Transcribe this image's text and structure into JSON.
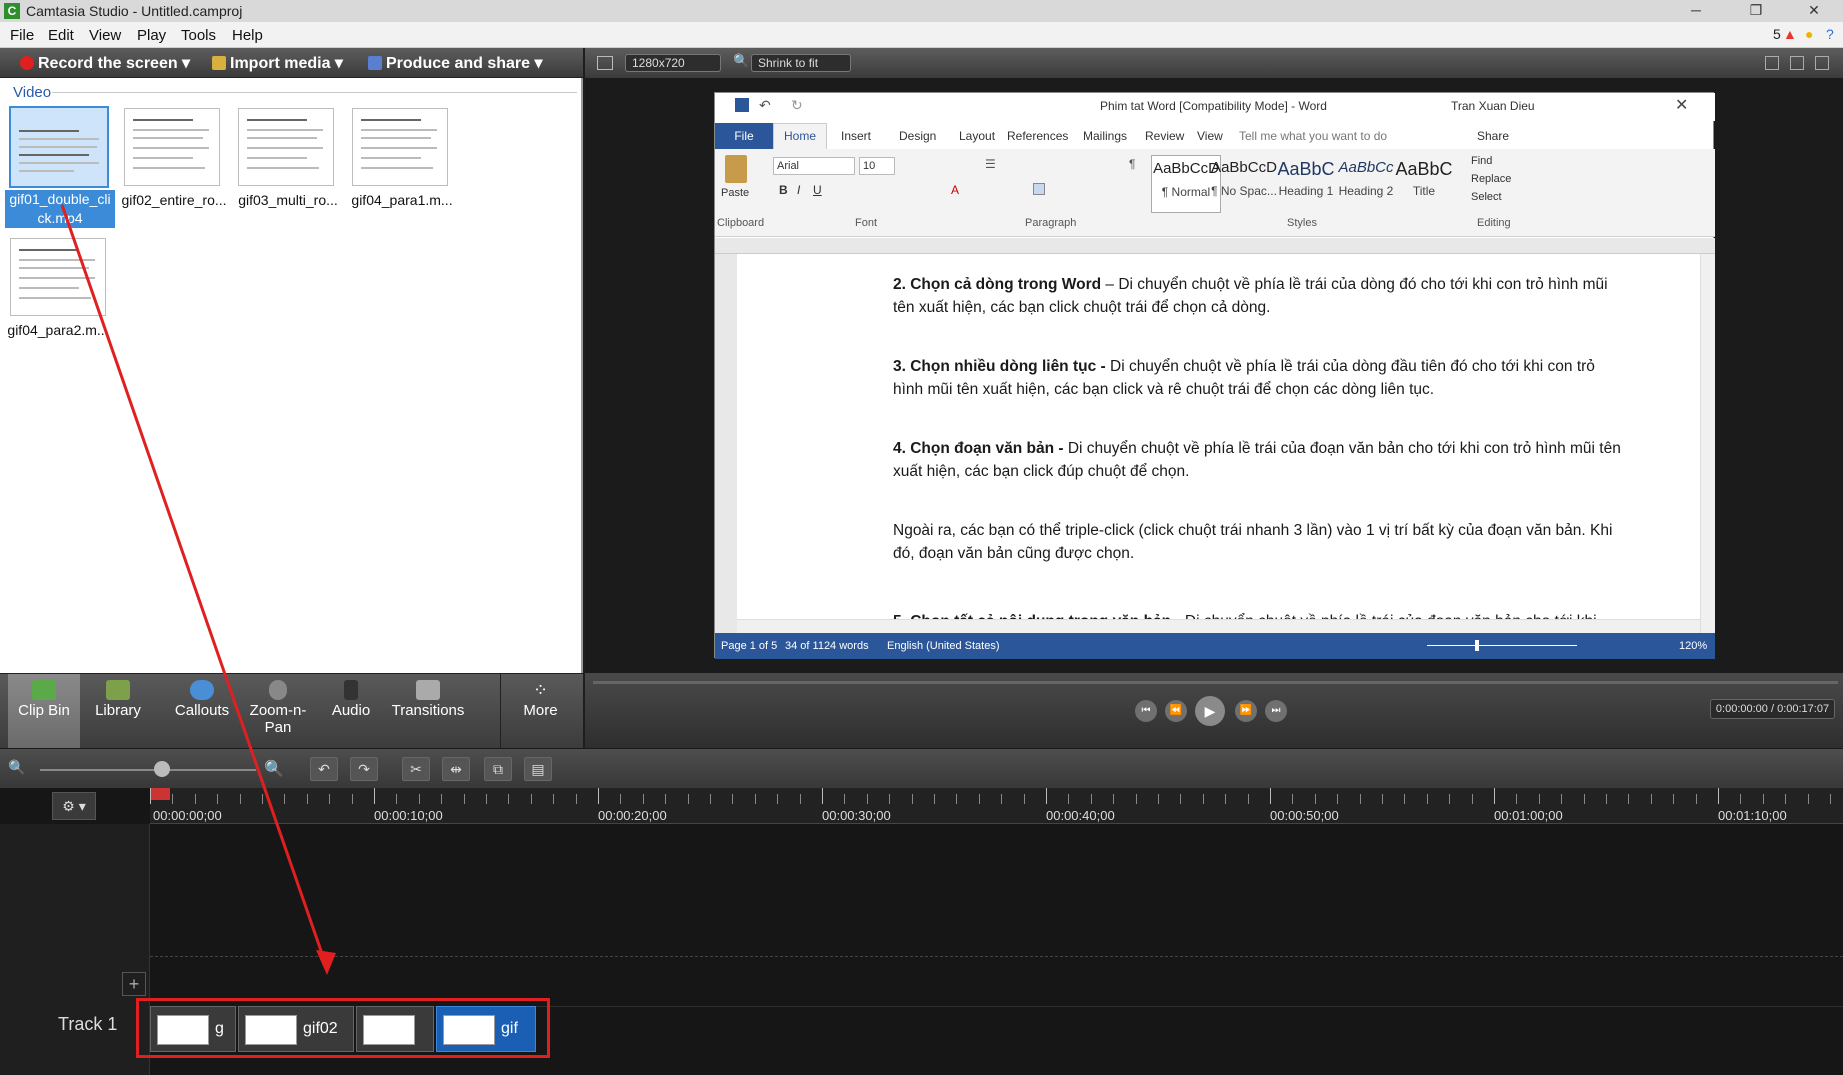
{
  "window": {
    "title": "Camtasia Studio - Untitled.camproj"
  },
  "menu": [
    "File",
    "Edit",
    "View",
    "Play",
    "Tools",
    "Help"
  ],
  "menu_right": {
    "notifications": "5"
  },
  "toolbar": {
    "record": "Record the screen",
    "import": "Import media",
    "produce": "Produce and share"
  },
  "clipbin": {
    "header": "Video",
    "clips": [
      {
        "name": "gif01_double_click.mp4",
        "display": "gif01_double_cli ck.mp4",
        "selected": true
      },
      {
        "name": "gif02_entire_ro...",
        "display": "gif02_entire_ro..."
      },
      {
        "name": "gif03_multi_ro...",
        "display": "gif03_multi_ro..."
      },
      {
        "name": "gif04_para1.m...",
        "display": "gif04_para1.m..."
      },
      {
        "name": "gif04_para2.m...",
        "display": "gif04_para2.m..."
      }
    ]
  },
  "tabs": [
    {
      "label": "Clip Bin",
      "active": true
    },
    {
      "label": "Library"
    },
    {
      "label": "Callouts"
    },
    {
      "label": "Zoom-n-Pan",
      "display": "Zoom-n-\nPan"
    },
    {
      "label": "Audio"
    },
    {
      "label": "Transitions"
    },
    {
      "label": "More"
    }
  ],
  "preview": {
    "resolution": "1280x720",
    "zoom": "Shrink to fit",
    "time": "0:00:00:00 / 0:00:17:07"
  },
  "word": {
    "title": "Phim tat Word [Compatibility Mode]  -  Word",
    "user": "Tran Xuan Dieu",
    "ribbon_tabs": [
      "File",
      "Home",
      "Insert",
      "Design",
      "Layout",
      "References",
      "Mailings",
      "Review",
      "View"
    ],
    "tell_me": "Tell me what you want to do",
    "share": "Share",
    "font": "Arial",
    "size": "10",
    "groups": [
      "Clipboard",
      "Font",
      "Paragraph",
      "Styles",
      "Editing"
    ],
    "paste": "Paste",
    "styles": [
      {
        "preview": "AaBbCcD",
        "name": "¶ Normal"
      },
      {
        "preview": "AaBbCcD",
        "name": "¶ No Spac..."
      },
      {
        "preview": "AaBbC",
        "name": "Heading 1"
      },
      {
        "preview": "AaBbCc",
        "name": "Heading 2"
      },
      {
        "preview": "AaBbC",
        "name": "Title"
      }
    ],
    "editing": [
      "Find",
      "Replace",
      "Select"
    ],
    "paragraphs": [
      {
        "bold": "2. Chọn cả dòng trong Word",
        "text": " – Di chuyển chuột về phía lề trái của dòng đó cho tới khi con trỏ hình mũi tên xuất hiện, các bạn click chuột trái để chọn cả dòng."
      },
      {
        "bold": "3. Chọn nhiều dòng liên tục -",
        "text": " Di chuyển chuột về phía lề trái của dòng đầu tiên đó cho tới khi con trỏ hình mũi tên xuất hiện, các bạn click và rê chuột trái để chọn các dòng liên tục."
      },
      {
        "bold": "4. Chọn đoạn văn bản -",
        "text": " Di chuyển chuột về phía lề trái của đoạn văn bản cho tới khi con trỏ hình mũi tên xuất hiện, các bạn click đúp chuột để chọn."
      },
      {
        "bold": "",
        "text": "Ngoài ra, các bạn có thể triple-click (click chuột trái nhanh 3 lần) vào 1 vị trí bất kỳ của đoạn văn bản. Khi đó, đoạn văn bản cũng được chọn."
      },
      {
        "bold": "5. Chọn tất cả nội dung trong văn bản -",
        "text": " Di chuyển chuột về phía lề trái của đoạn văn bản cho tới khi"
      }
    ],
    "status": {
      "page": "Page 1 of 5",
      "words": "34 of 1124 words",
      "language": "English (United States)",
      "zoom": "120%"
    }
  },
  "timeline": {
    "timecodes": [
      "00:00:00;00",
      "00:00:10;00",
      "00:00:20;00",
      "00:00:30;00",
      "00:00:40;00",
      "00:00:50;00",
      "00:01:00;00",
      "00:01:10;00"
    ],
    "track_label": "Track 1",
    "clips": [
      "g",
      "gif02",
      "",
      "gif"
    ]
  }
}
